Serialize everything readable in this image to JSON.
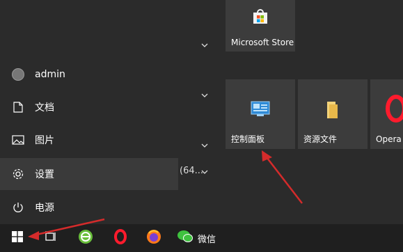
{
  "start_menu": {
    "user": {
      "name": "admin"
    },
    "rail_items": [
      {
        "label": "文档"
      },
      {
        "label": "图片"
      },
      {
        "label": "设置"
      },
      {
        "label": "电源"
      }
    ],
    "app_list_fragment": "(64..."
  },
  "tiles": {
    "microsoft_store": {
      "label": "Microsoft Store"
    },
    "control_panel": {
      "label": "控制面板"
    },
    "resource_files": {
      "label": "资源文件"
    },
    "opera": {
      "label": "Opera 浏"
    }
  },
  "taskbar": {
    "wechat_label": "微信"
  },
  "colors": {
    "accent_red": "#d42b2b",
    "tile_bg": "#3c3c3c",
    "menu_bg": "#2b2b2b",
    "taskbar_bg": "#1f1f1f"
  }
}
